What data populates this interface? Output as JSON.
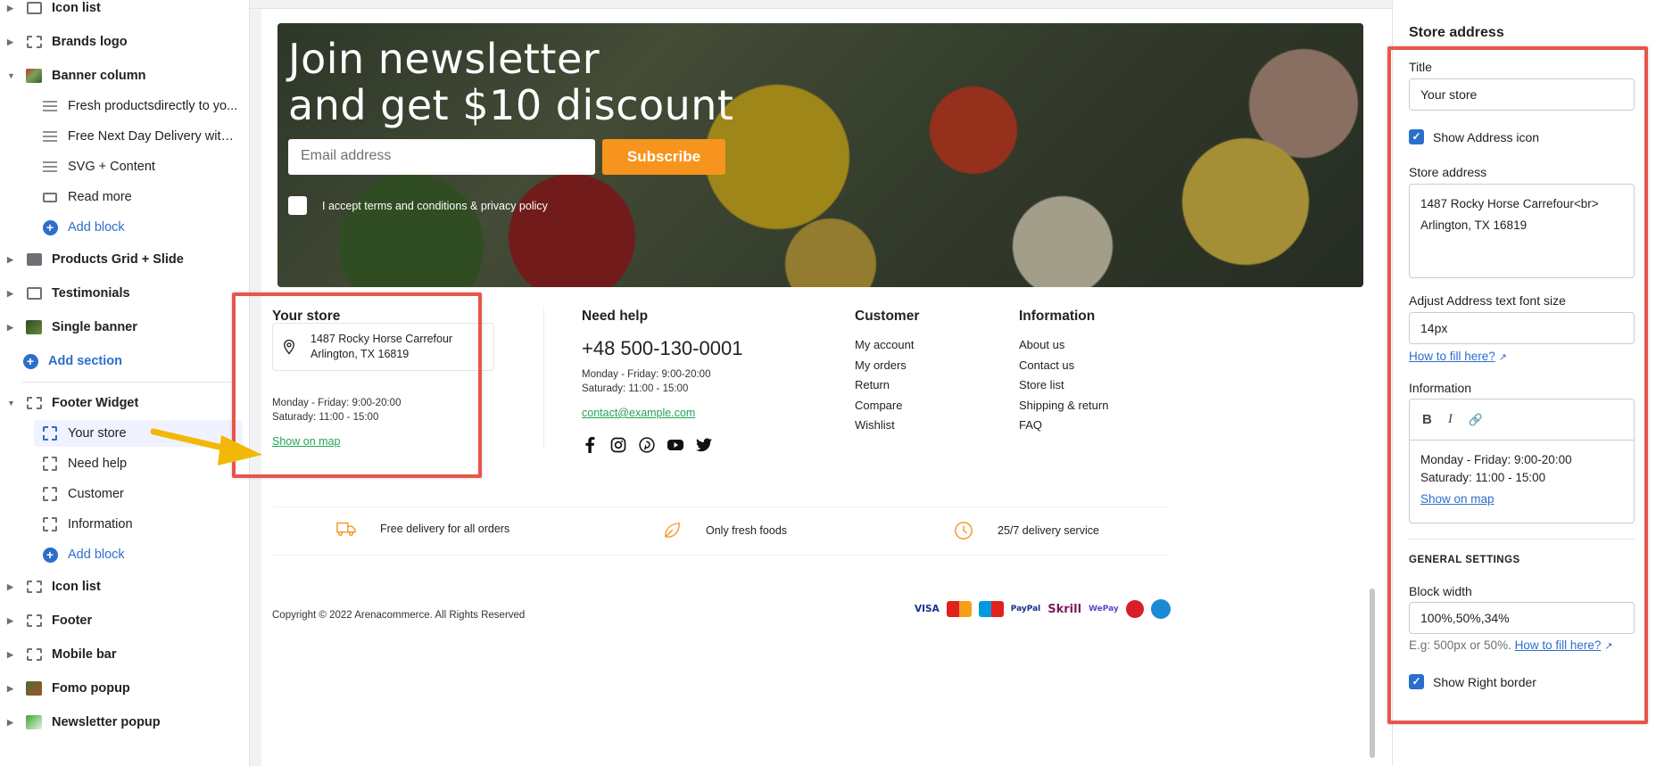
{
  "sidebar": {
    "items": [
      {
        "label": "Icon list",
        "type": "section",
        "top": 0
      },
      {
        "label": "Brands logo",
        "type": "section"
      },
      {
        "label": "Banner column",
        "type": "section"
      },
      {
        "label": "Fresh productsdirectly to yo...",
        "type": "block"
      },
      {
        "label": "Free Next Day Delivery withi...",
        "type": "block"
      },
      {
        "label": "SVG + Content",
        "type": "block"
      },
      {
        "label": "Read more",
        "type": "block"
      },
      {
        "label": "Add block",
        "type": "add"
      },
      {
        "label": "Products Grid + Slide",
        "type": "section"
      },
      {
        "label": "Testimonials",
        "type": "section"
      },
      {
        "label": "Single banner",
        "type": "section"
      },
      {
        "label": "Add section",
        "type": "add"
      },
      {
        "label": "Footer Widget",
        "type": "section"
      },
      {
        "label": "Your store",
        "type": "block"
      },
      {
        "label": "Need help",
        "type": "block"
      },
      {
        "label": "Customer",
        "type": "block"
      },
      {
        "label": "Information",
        "type": "block"
      },
      {
        "label": "Add block",
        "type": "add"
      },
      {
        "label": "Icon list",
        "type": "section"
      },
      {
        "label": "Footer",
        "type": "section"
      },
      {
        "label": "Mobile bar",
        "type": "section"
      },
      {
        "label": "Fomo popup",
        "type": "section"
      },
      {
        "label": "Newsletter popup",
        "type": "section"
      }
    ]
  },
  "preview": {
    "banner": {
      "title_line1": "Join newsletter",
      "title_line2": "and get $10 discount",
      "email_placeholder": "Email address",
      "subscribe_label": "Subscribe",
      "terms_label": "I accept terms and conditions & privacy policy"
    },
    "footer": {
      "store": {
        "title": "Your store",
        "address_line1": "1487 Rocky Horse Carrefour",
        "address_line2": "Arlington, TX 16819",
        "hours_line1": "Monday - Friday: 9:00-20:00",
        "hours_line2": "Saturady: 11:00 - 15:00",
        "map_link": "Show on map"
      },
      "help": {
        "title": "Need help",
        "phone": "+48 500-130-0001",
        "hours_line1": "Monday - Friday: 9:00-20:00",
        "hours_line2": "Saturady: 11:00 - 15:00",
        "email": "contact@example.com"
      },
      "customer": {
        "title": "Customer",
        "items": [
          "My account",
          "My orders",
          "Return",
          "Compare",
          "Wishlist"
        ]
      },
      "information": {
        "title": "Information",
        "items": [
          "About us",
          "Contact us",
          "Store list",
          "Shipping & return",
          "FAQ"
        ]
      },
      "features": [
        {
          "icon": "truck-icon",
          "label": "Free delivery for all orders"
        },
        {
          "icon": "leaf-icon",
          "label": "Only fresh foods"
        },
        {
          "icon": "clock-icon",
          "label": "25/7 delivery service"
        }
      ],
      "copyright": "Copyright © 2022 Arenacommerce. All Rights Reserved",
      "payments": [
        "VISA",
        "Mastercard",
        "Maestro",
        "PayPal",
        "Skrill",
        "WePay",
        "Unknown",
        "SlicePay"
      ]
    }
  },
  "panel": {
    "heading": "Store address",
    "title_label": "Title",
    "title_value": "Your store",
    "show_icon_label": "Show Address icon",
    "address_label": "Store address",
    "address_value_line1": "1487 Rocky Horse Carrefour<br>",
    "address_value_line2": "Arlington, TX 16819",
    "font_size_label": "Adjust Address text font size",
    "font_size_value": "14px",
    "how_to_link": "How to fill here?",
    "information_label": "Information",
    "info_line1": "Monday - Friday: 9:00-20:00",
    "info_line2": "Saturady: 11:00 - 15:00",
    "info_link": "Show on map",
    "general_settings": "GENERAL SETTINGS",
    "block_width_label": "Block width",
    "block_width_value": "100%,50%,34%",
    "block_width_help": "E.g: 500px or 50%.",
    "block_width_link": "How to fill here?",
    "show_right_border_label": "Show Right border"
  },
  "colors": {
    "accent": "#2c6ecb",
    "subscribe": "#f7941d",
    "highlight": "#e8564a",
    "arrow": "#f2b807",
    "link_green": "#23a455"
  }
}
